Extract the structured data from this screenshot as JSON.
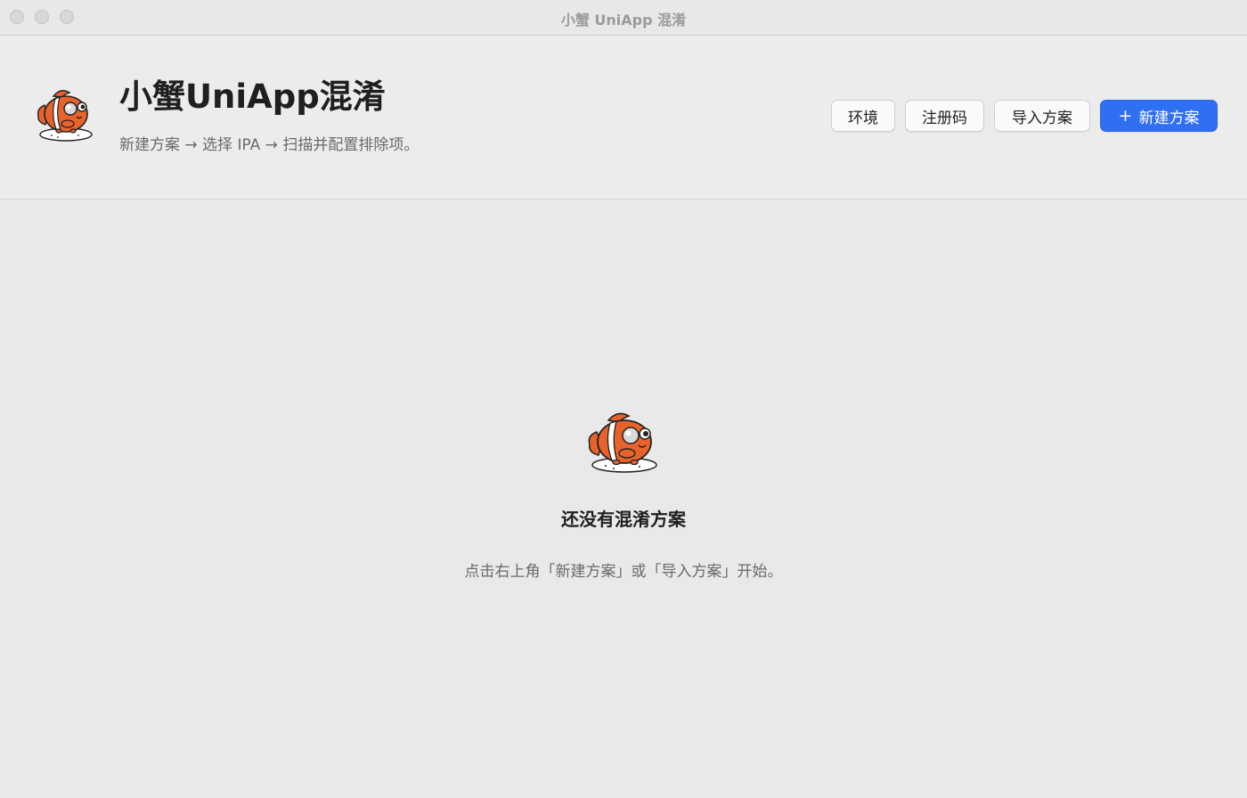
{
  "window": {
    "title": "小蟹 UniApp 混淆"
  },
  "header": {
    "logo_icon": "clownfish-logo-icon",
    "title": "小蟹UniApp混淆",
    "subtitle": "新建方案 → 选择 IPA → 扫描并配置排除项。",
    "buttons": {
      "environment": "环境",
      "registration_code": "注册码",
      "import_plan": "导入方案",
      "new_plan": "新建方案",
      "new_plan_icon": "plus-icon"
    }
  },
  "empty_state": {
    "icon": "clownfish-icon",
    "title": "还没有混淆方案",
    "hint": "点击右上角「新建方案」或「导入方案」开始。"
  },
  "colors": {
    "accent": "#2f6ff2",
    "background": "#e9e9e9",
    "fish_orange": "#e8632c"
  }
}
